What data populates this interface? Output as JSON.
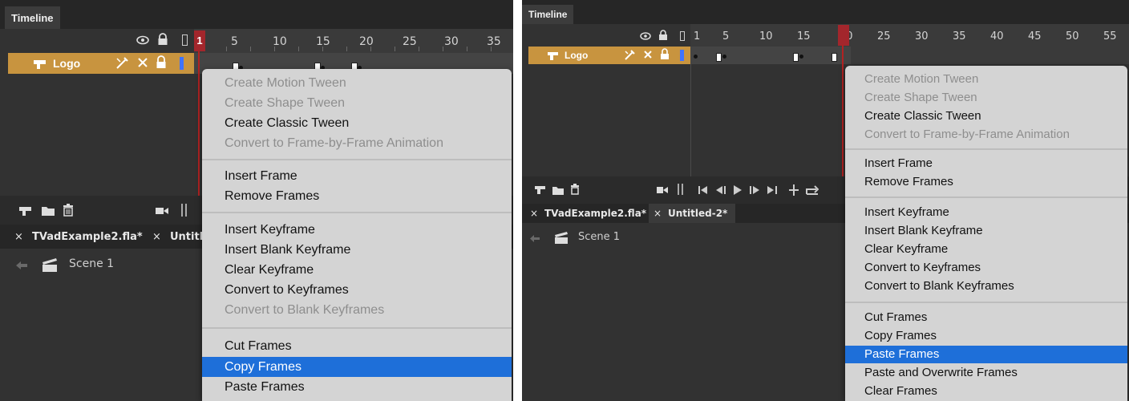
{
  "colors": {
    "panel_bg": "#323232",
    "layer_highlight": "#c8943f",
    "playhead": "#b22222",
    "menu_bg": "#d4d4d4",
    "menu_selected": "#1e6fd9",
    "menu_disabled_text": "#8e8e8e"
  },
  "left": {
    "panel_tab": "Timeline",
    "ruler_numbers": [
      "1",
      "5",
      "10",
      "15",
      "20",
      "25",
      "30",
      "35"
    ],
    "layer": {
      "name": "Logo"
    },
    "doc_tabs": [
      {
        "close": "×",
        "label": "TVadExample2.fla*"
      },
      {
        "close": "×",
        "label": "Untitl"
      }
    ],
    "scene": "Scene 1",
    "menu": {
      "items": [
        {
          "label": "Create Motion Tween",
          "state": "disabled"
        },
        {
          "label": "Create Shape Tween",
          "state": "disabled"
        },
        {
          "label": "Create Classic Tween",
          "state": "enabled"
        },
        {
          "label": "Convert to Frame-by-Frame Animation",
          "state": "disabled"
        },
        {
          "label": "Insert Frame",
          "state": "enabled"
        },
        {
          "label": "Remove Frames",
          "state": "enabled"
        },
        {
          "label": "Insert Keyframe",
          "state": "enabled"
        },
        {
          "label": "Insert Blank Keyframe",
          "state": "enabled"
        },
        {
          "label": "Clear Keyframe",
          "state": "enabled"
        },
        {
          "label": "Convert to Keyframes",
          "state": "enabled"
        },
        {
          "label": "Convert to Blank Keyframes",
          "state": "disabled"
        },
        {
          "label": "Cut Frames",
          "state": "enabled"
        },
        {
          "label": "Copy Frames",
          "state": "selected"
        },
        {
          "label": "Paste Frames",
          "state": "enabled"
        }
      ]
    }
  },
  "right": {
    "panel_tab": "Timeline",
    "ruler_numbers": [
      "1",
      "5",
      "10",
      "15",
      "20",
      "25",
      "30",
      "35",
      "40",
      "45",
      "50",
      "55"
    ],
    "layer": {
      "name": "Logo"
    },
    "doc_tabs": [
      {
        "close": "×",
        "label": "TVadExample2.fla*"
      },
      {
        "close": "×",
        "label": "Untitled-2*"
      }
    ],
    "scene": "Scene 1",
    "menu": {
      "items": [
        {
          "label": "Create Motion Tween",
          "state": "disabled"
        },
        {
          "label": "Create Shape Tween",
          "state": "disabled"
        },
        {
          "label": "Create Classic Tween",
          "state": "enabled"
        },
        {
          "label": "Convert to Frame-by-Frame Animation",
          "state": "disabled"
        },
        {
          "label": "Insert Frame",
          "state": "enabled"
        },
        {
          "label": "Remove Frames",
          "state": "enabled"
        },
        {
          "label": "Insert Keyframe",
          "state": "enabled"
        },
        {
          "label": "Insert Blank Keyframe",
          "state": "enabled"
        },
        {
          "label": "Clear Keyframe",
          "state": "enabled"
        },
        {
          "label": "Convert to Keyframes",
          "state": "enabled"
        },
        {
          "label": "Convert to Blank Keyframes",
          "state": "enabled"
        },
        {
          "label": "Cut Frames",
          "state": "enabled"
        },
        {
          "label": "Copy Frames",
          "state": "enabled"
        },
        {
          "label": "Paste Frames",
          "state": "selected"
        },
        {
          "label": "Paste and Overwrite Frames",
          "state": "enabled"
        },
        {
          "label": "Clear Frames",
          "state": "enabled"
        }
      ]
    }
  }
}
